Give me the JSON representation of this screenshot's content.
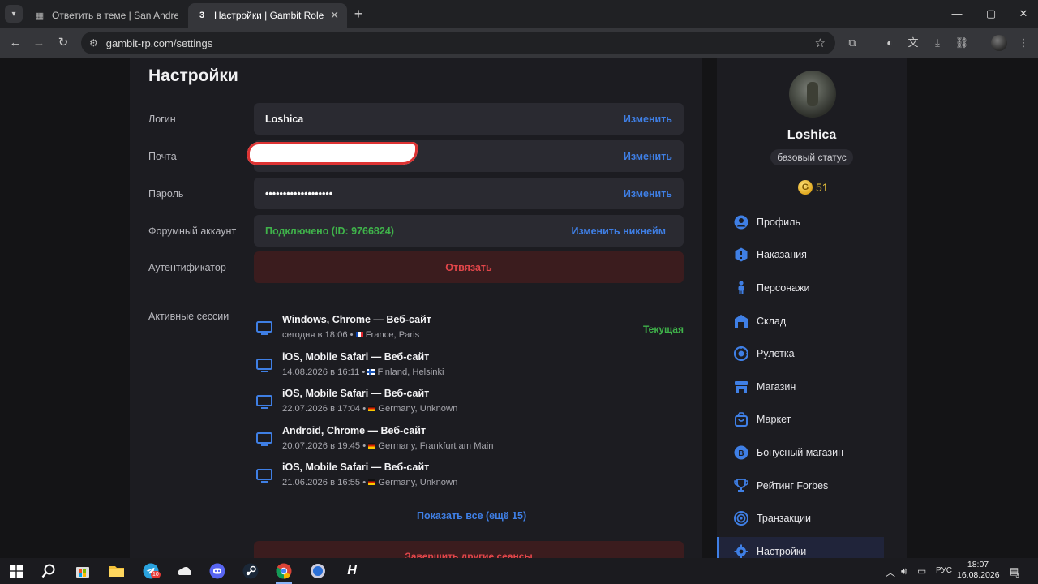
{
  "browser": {
    "tabs": [
      {
        "title": "Ответить в теме | San Andreas",
        "active": false
      },
      {
        "title": "Настройки | Gambit Role Play",
        "active": true
      }
    ],
    "url": "gambit-rp.com/settings"
  },
  "settings": {
    "title": "Настройки",
    "rows": [
      {
        "label": "Логин",
        "value": "Loshica",
        "action": "Изменить"
      },
      {
        "label": "Почта",
        "value": "",
        "action": "Изменить"
      },
      {
        "label": "Пароль",
        "value": "•••••••••••••••••••",
        "action": "Изменить"
      },
      {
        "label": "Форумный аккаунт",
        "value": "Подключено (ID: 9766824)",
        "action": "Изменить никнейм"
      },
      {
        "label": "Аутентификатор",
        "value": "",
        "action": "Отвязать"
      }
    ],
    "sessions_label": "Активные сессии",
    "sessions": [
      {
        "title": "Windows, Chrome — Веб-сайт",
        "time": "сегодня в 18:06",
        "flag": "fr",
        "location": "France, Paris",
        "badge": "Текущая"
      },
      {
        "title": "iOS, Mobile Safari — Веб-сайт",
        "time": "14.08.2026 в 16:11",
        "flag": "fi",
        "location": "Finland, Helsinki",
        "badge": ""
      },
      {
        "title": "iOS, Mobile Safari — Веб-сайт",
        "time": "22.07.2026 в 17:04",
        "flag": "de",
        "location": "Germany, Unknown",
        "badge": ""
      },
      {
        "title": "Android, Chrome — Веб-сайт",
        "time": "20.07.2026 в 19:45",
        "flag": "de",
        "location": "Germany, Frankfurt am Main",
        "badge": ""
      },
      {
        "title": "iOS, Mobile Safari — Веб-сайт",
        "time": "21.06.2026 в 16:55",
        "flag": "de",
        "location": "Germany, Unknown",
        "badge": ""
      }
    ],
    "show_all": "Показать все (ещё 15)",
    "end_sessions": "Завершить другие сеансы"
  },
  "profile": {
    "name": "Loshica",
    "status": "базовый статус",
    "coins": "51"
  },
  "sidebar": {
    "items": [
      {
        "label": "Профиль",
        "icon": "user-icon"
      },
      {
        "label": "Наказания",
        "icon": "alert-icon"
      },
      {
        "label": "Персонажи",
        "icon": "person-icon"
      },
      {
        "label": "Склад",
        "icon": "warehouse-icon"
      },
      {
        "label": "Рулетка",
        "icon": "roulette-icon"
      },
      {
        "label": "Магазин",
        "icon": "store-icon"
      },
      {
        "label": "Маркет",
        "icon": "bag-icon"
      },
      {
        "label": "Бонусный магазин",
        "icon": "bonus-icon"
      },
      {
        "label": "Рейтинг Forbes",
        "icon": "trophy-icon"
      },
      {
        "label": "Транзакции",
        "icon": "transactions-icon"
      },
      {
        "label": "Настройки",
        "icon": "gear-icon"
      }
    ]
  },
  "taskbar": {
    "lang": "РУС",
    "time": "18:07",
    "date": "16.08.2026",
    "telegram_badge": "10",
    "notif_count": "3"
  },
  "colors": {
    "accent": "#3f7fe5",
    "success": "#3fb24a",
    "danger": "#e2464a"
  }
}
